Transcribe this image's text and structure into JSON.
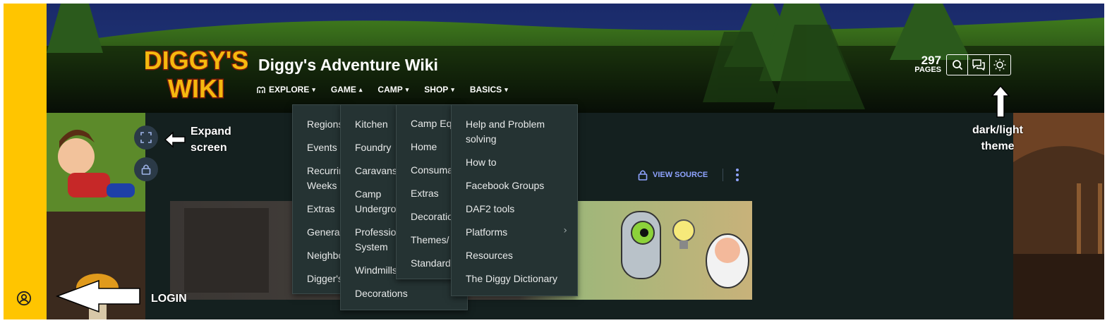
{
  "site": {
    "logo_text_line1": "DIGGY'S",
    "logo_text_line2": "WIKI",
    "title": "Diggy's Adventure Wiki"
  },
  "nav": [
    {
      "label": "EXPLORE",
      "caret": "▾",
      "icon": "explore-icon"
    },
    {
      "label": "GAME",
      "caret": "▴"
    },
    {
      "label": "CAMP",
      "caret": "▾"
    },
    {
      "label": "SHOP",
      "caret": "▾"
    },
    {
      "label": "BASICS",
      "caret": "▾"
    }
  ],
  "pages": {
    "count": "297",
    "label": "PAGES"
  },
  "tools": [
    "search-icon",
    "discussions-icon",
    "theme-toggle-icon"
  ],
  "page_actions": {
    "view_source": "VIEW SOURCE"
  },
  "menus": {
    "explore": [
      "Regions",
      "Events",
      "Recurring",
      "Weeks",
      "Extras",
      "General",
      "Neighbours",
      "Digger's"
    ],
    "game": [
      "Kitchen",
      "Foundry",
      "Caravans",
      "Camp",
      "Underground",
      "Professions",
      "System",
      "Windmills",
      "Decorations"
    ],
    "camp": [
      "Camp Equipment",
      "Home",
      "Consumables",
      "Extras",
      "Decorations",
      "Themes/",
      "Standard"
    ],
    "basics": [
      "Help and Problem",
      "solving",
      "How to",
      "Facebook Groups",
      "DAF2 tools",
      "Platforms",
      "Resources",
      "The Diggy Dictionary"
    ]
  },
  "annotations": {
    "expand_line1": "Expand",
    "expand_line2": "screen",
    "theme_line1": "dark/light",
    "theme_line2": "theme",
    "login": "LOGIN"
  },
  "colors": {
    "left_bar": "#ffc500",
    "menu_bg": "#253333",
    "link_accent": "#8fa3ff",
    "content_bg": "#14201f"
  }
}
